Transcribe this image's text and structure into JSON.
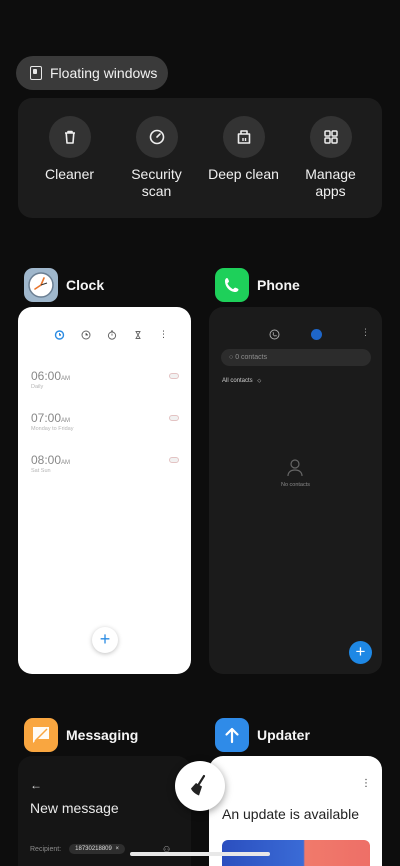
{
  "floating_windows": {
    "label": "Floating windows",
    "icon": "floating-window-icon"
  },
  "tools": [
    {
      "label": "Cleaner",
      "icon": "trash-icon"
    },
    {
      "label": "Security scan",
      "icon": "speedometer-icon"
    },
    {
      "label": "Deep clean",
      "icon": "deep-clean-icon"
    },
    {
      "label": "Manage apps",
      "icon": "grid-icon"
    }
  ],
  "apps": {
    "clock": {
      "name": "Clock",
      "alarms": [
        {
          "time": "06:00",
          "ampm": "AM",
          "sub": "Daily"
        },
        {
          "time": "07:00",
          "ampm": "AM",
          "sub": "Monday to Friday"
        },
        {
          "time": "08:00",
          "ampm": "AM",
          "sub": "Sat Sun"
        }
      ],
      "fab": "+"
    },
    "phone": {
      "name": "Phone",
      "search_placeholder": "0 contacts",
      "filter": "All contacts",
      "empty": "No contacts",
      "fab": "+"
    },
    "messaging": {
      "name": "Messaging",
      "back": "←",
      "title": "New message",
      "recipient_label": "Recipient:",
      "recipient_value": "18730218809"
    },
    "updater": {
      "name": "Updater",
      "menu": "⋮",
      "message": "An update is available"
    }
  },
  "colors": {
    "background": "#0d0d0d",
    "phone_green": "#1ed05a",
    "updater_blue": "#2f8be8",
    "messaging_orange": "#f9a640",
    "fab_blue": "#1e88e5"
  }
}
